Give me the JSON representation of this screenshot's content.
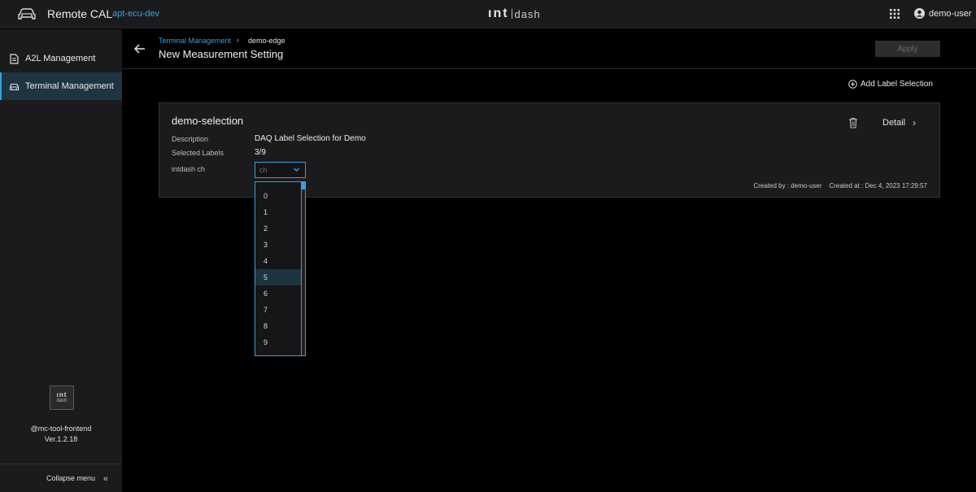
{
  "header": {
    "app_title": "Remote CAL",
    "env_name": "apt-ecu-dev",
    "brand_int": "ınt",
    "brand_dash": "dash",
    "user_name": "demo-user",
    "icons": [
      "car-icon",
      "apps-grid-icon",
      "user-circle-icon"
    ]
  },
  "sidebar": {
    "items": [
      {
        "label": "A2L Management",
        "icon": "document-icon",
        "active": false
      },
      {
        "label": "Terminal Management",
        "icon": "vehicle-icon",
        "active": true
      }
    ],
    "logo_line1": "ınt",
    "logo_line2": "dash",
    "package_name": "@mc-tool-frontend",
    "version": "Ver.1.2.18",
    "collapse_label": "Collapse menu",
    "collapse_glyph": "«"
  },
  "main": {
    "breadcrumb": {
      "parent": "Terminal Management",
      "separator": "›",
      "current": "demo-edge"
    },
    "page_title": "New Measurement Setting",
    "apply_label": "Apply",
    "add_label_selection": "Add Label Selection"
  },
  "card": {
    "title": "demo-selection",
    "detail_label": "Detail",
    "detail_glyph": "›",
    "description_label": "Description",
    "description_value": "DAQ Label Selection for Demo",
    "selected_labels_label": "Selected Labels",
    "selected_labels_value": "3/9",
    "intdash_ch_label": "intdash ch",
    "select_placeholder": "ch",
    "created_by_label": "Created by :",
    "created_by_value": "demo-user",
    "created_at_label": "Created at :",
    "created_at_value": "Dec 4, 2023 17:29:57"
  },
  "dropdown": {
    "options": [
      "0",
      "1",
      "2",
      "3",
      "4",
      "5",
      "6",
      "7",
      "8",
      "9"
    ],
    "highlighted": "5"
  },
  "colors": {
    "accent": "#3a9fdc",
    "panel": "#1b1b1d",
    "background": "#000000",
    "active_row": "#1e3441"
  }
}
